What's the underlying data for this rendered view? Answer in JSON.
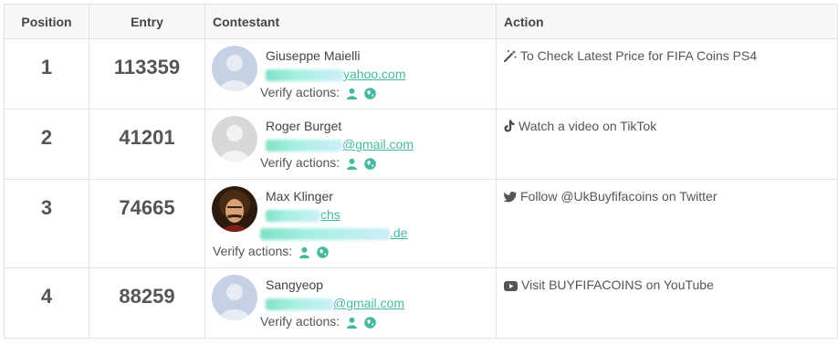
{
  "headers": {
    "position": "Position",
    "entry": "Entry",
    "contestant": "Contestant",
    "action": "Action"
  },
  "verify_label": "Verify actions:",
  "colors": {
    "accent": "#44b9a0",
    "avatar_placeholder": "#c7d1e5"
  },
  "rows": [
    {
      "position": "1",
      "entry": "113359",
      "name": "Giuseppe Maielli",
      "email_visible": "yahoo.com",
      "action": "To Check Latest Price for FIFA Coins PS4",
      "action_icon": "magic-wand-icon"
    },
    {
      "position": "2",
      "entry": "41201",
      "name": "Roger Burget",
      "email_visible": "@gmail.com",
      "action": "Watch a video on TikTok",
      "action_icon": "tiktok-icon"
    },
    {
      "position": "3",
      "entry": "74665",
      "name": "Max Klinger",
      "handle_visible": "chs",
      "email_visible": ".de",
      "action": "Follow @UkBuyfifacoins on Twitter",
      "action_icon": "twitter-icon"
    },
    {
      "position": "4",
      "entry": "88259",
      "name": "Sangyeop",
      "email_visible": "@gmail.com",
      "action": "Visit BUYFIFACOINS on YouTube",
      "action_icon": "youtube-icon"
    }
  ]
}
